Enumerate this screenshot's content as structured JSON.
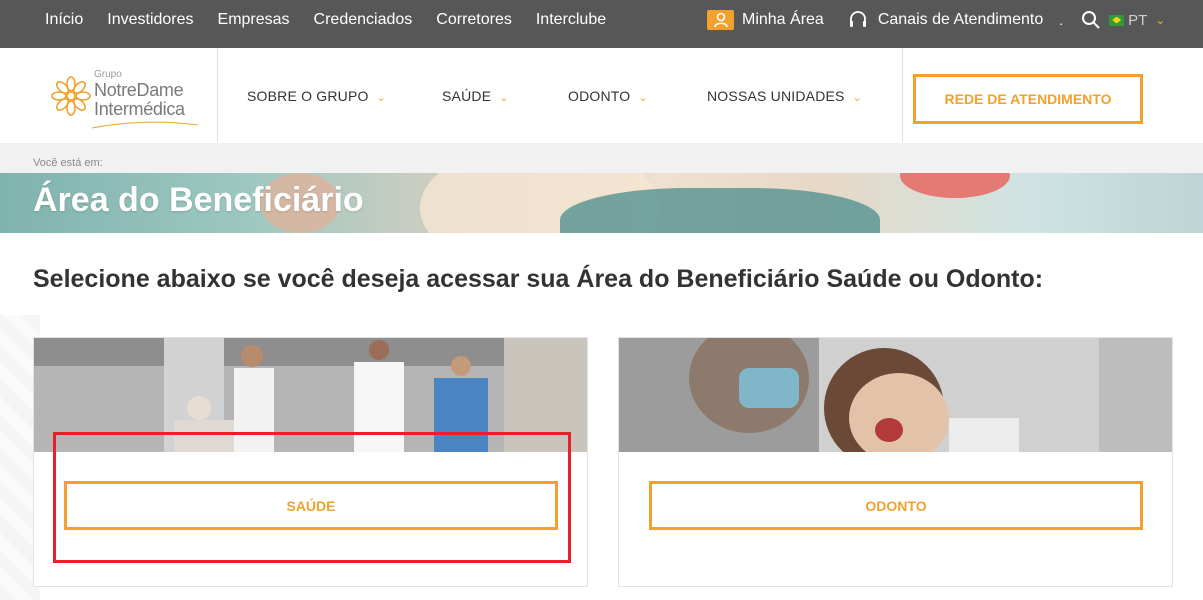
{
  "topbar": {
    "links": [
      "Início",
      "Investidores",
      "Empresas",
      "Credenciados",
      "Corretores",
      "Interclube"
    ],
    "minha_area": "Minha Área",
    "canais": "Canais de Atendimento",
    "dot": ".",
    "lang": "PT"
  },
  "logo": {
    "grupo": "Grupo",
    "line1": "NotreDame",
    "line2": "Intermédica"
  },
  "mainnav": {
    "items": [
      "SOBRE O GRUPO",
      "SAÚDE",
      "ODONTO",
      "NOSSAS UNIDADES"
    ],
    "rede_button": "REDE DE ATENDIMENTO"
  },
  "breadcrumb": "Você está em:",
  "hero_title": "Área do Beneficiário",
  "heading": "Selecione abaixo se você deseja acessar sua Área do Beneficiário Saúde ou Odonto:",
  "cards": [
    {
      "button": "SAÚDE"
    },
    {
      "button": "ODONTO"
    }
  ],
  "colors": {
    "accent": "#f2a22c",
    "topbar": "#575757",
    "highlight": "#e8202a"
  }
}
